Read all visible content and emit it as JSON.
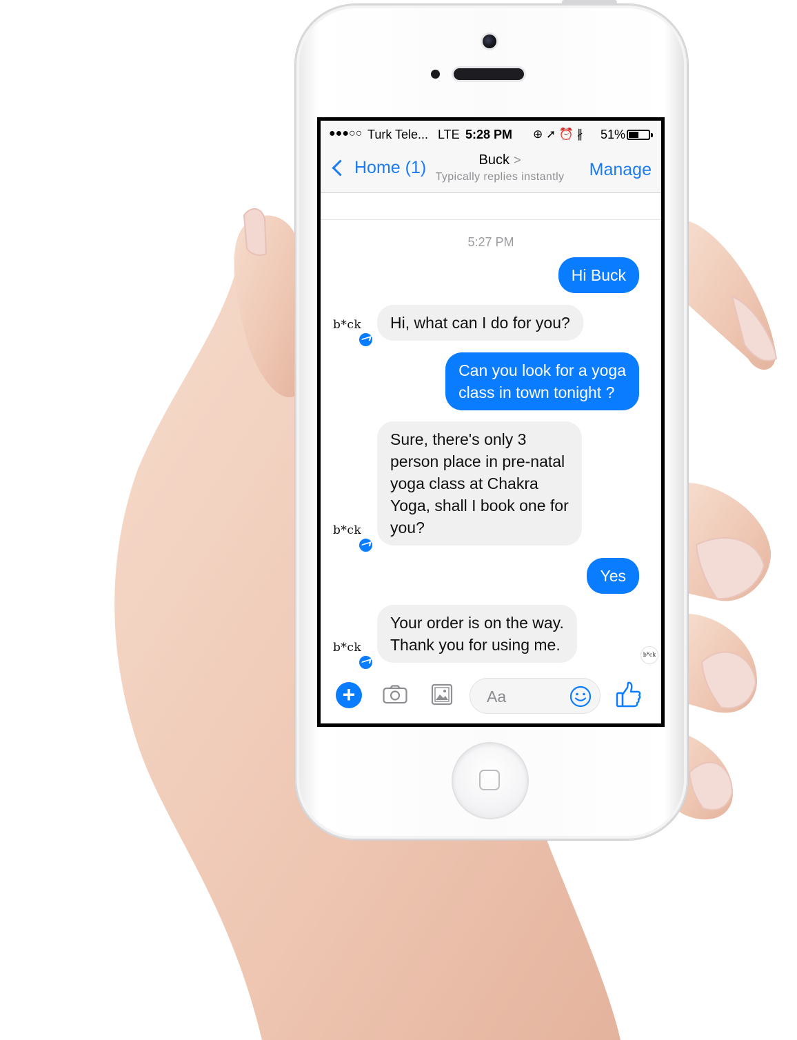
{
  "status_bar": {
    "signal": "●●●○○",
    "carrier": "Turk Tele...",
    "network": "LTE",
    "time": "5:28 PM",
    "icons": "⊕ ➚ ⏰ ∦",
    "battery_percent": "51%",
    "battery_level": 0.51
  },
  "nav": {
    "back_label": "Home (1)",
    "contact_name": "Buck",
    "contact_subtitle": "Typically replies instantly",
    "manage_label": "Manage"
  },
  "thread": {
    "timestamp": "5:27 PM",
    "bot_avatar_text": "b*ck",
    "messages": [
      {
        "from": "user",
        "text": "Hi Buck"
      },
      {
        "from": "bot",
        "text": "Hi, what can I do for you?"
      },
      {
        "from": "user",
        "text": "Can you look for a yoga\nclass in town tonight ?"
      },
      {
        "from": "bot",
        "text": "Sure, there's only 3\nperson place in pre-natal\nyoga class at Chakra\nYoga, shall I book one for\nyou?"
      },
      {
        "from": "user",
        "text": "Yes"
      },
      {
        "from": "bot",
        "text": "Your order is on the way.\nThank you for using me."
      }
    ],
    "seen_avatar_text": "b*ck"
  },
  "composer": {
    "placeholder": "Aa"
  },
  "colors": {
    "accent": "#0a7cff",
    "link": "#1d7bf0",
    "incoming_bubble": "#f1f0f0"
  }
}
